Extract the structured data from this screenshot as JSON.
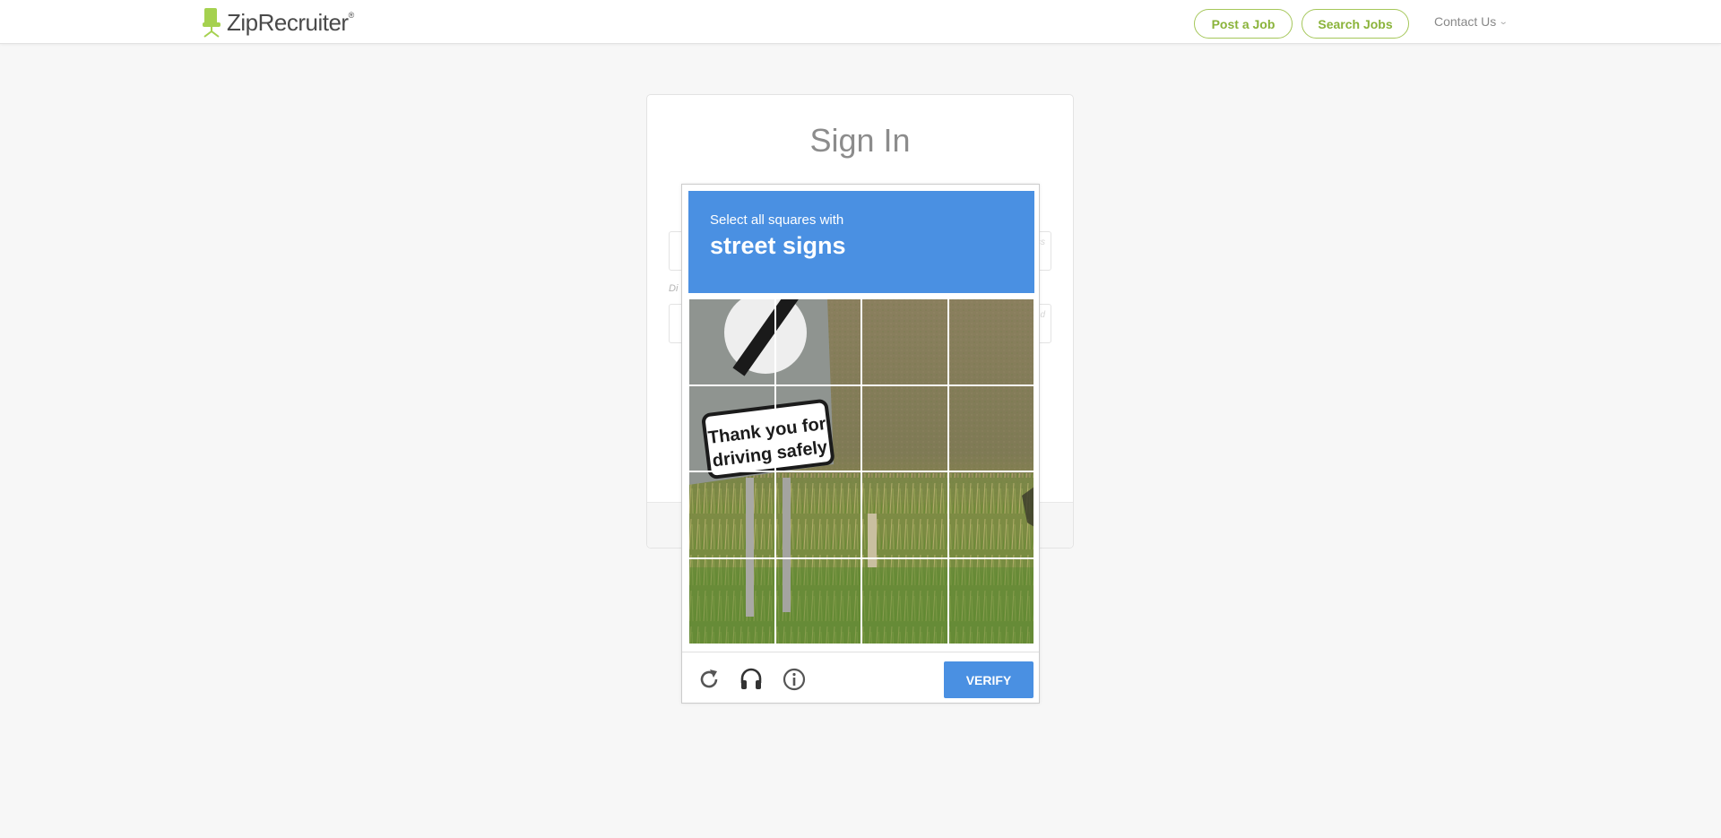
{
  "header": {
    "brand": "ZipRecruiter",
    "brand_mark": "®",
    "post_job": "Post a Job",
    "search_jobs": "Search Jobs",
    "contact": "Contact Us"
  },
  "signin": {
    "title": "Sign In"
  },
  "captcha": {
    "prompt": "Select all squares with",
    "target": "street signs",
    "verify_label": "VERIFY",
    "sign_line1": "Thank you for",
    "sign_line2": "driving safely",
    "accent_color": "#4a90e2",
    "icons": [
      "reload-icon",
      "headphones-icon",
      "info-icon"
    ]
  },
  "colors": {
    "brand_green": "#8ab33a",
    "captcha_blue": "#4a90e2"
  }
}
